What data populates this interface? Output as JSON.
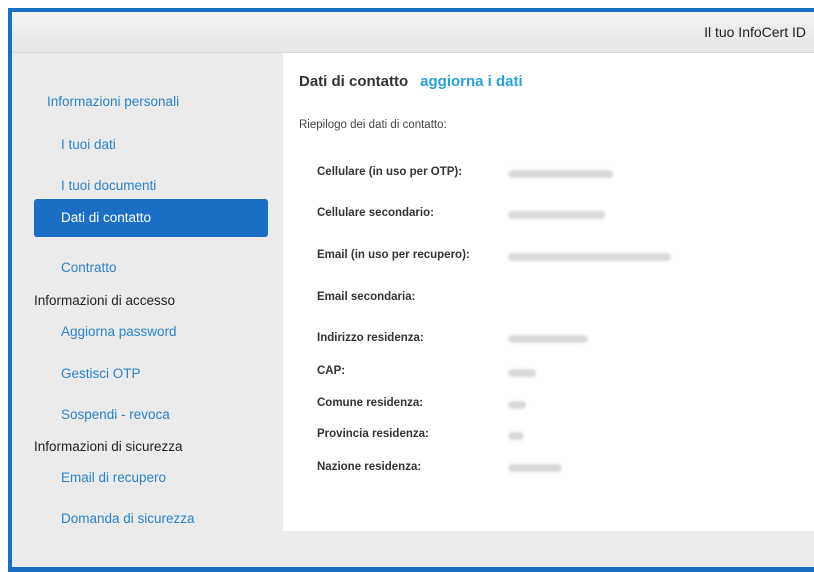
{
  "header": {
    "title": "Il tuo InfoCert ID"
  },
  "sidebar": {
    "sections": [
      {
        "label": "Informazioni personali",
        "is_link": true
      },
      {
        "label": "Informazioni di accesso",
        "is_link": false
      },
      {
        "label": "Informazioni di sicurezza",
        "is_link": false
      }
    ],
    "items": [
      {
        "label": "I tuoi dati"
      },
      {
        "label": "I tuoi documenti"
      },
      {
        "label": "Dati di contatto",
        "active": true
      },
      {
        "label": "Contratto"
      },
      {
        "label": "Aggiorna password"
      },
      {
        "label": "Gestisci OTP"
      },
      {
        "label": "Sospendi - revoca"
      },
      {
        "label": "Email di recupero"
      },
      {
        "label": "Domanda di sicurezza"
      }
    ]
  },
  "main": {
    "title": "Dati di contatto",
    "update_link": "aggiorna i dati",
    "summary": "Riepilogo dei dati di contatto:",
    "fields": [
      {
        "label": "Cellulare (in uso per OTP):",
        "value_hidden": true
      },
      {
        "label": "Cellulare secondario:",
        "value_hidden": true
      },
      {
        "label": "Email (in uso per recupero):",
        "value_hidden": true
      },
      {
        "label": "Email secondaria:",
        "value_hidden": false
      },
      {
        "label": "Indirizzo residenza:",
        "value_hidden": true
      },
      {
        "label": "CAP:",
        "value_hidden": true
      },
      {
        "label": "Comune residenza:",
        "value_hidden": true
      },
      {
        "label": "Provincia residenza:",
        "value_hidden": true
      },
      {
        "label": "Nazione residenza:",
        "value_hidden": true
      }
    ]
  },
  "colors": {
    "accent": "#1a6fc4",
    "link": "#2a83c9",
    "update_link": "#2a9fd8",
    "sidebar_bg": "#ebebeb",
    "content_bg": "#ffffff"
  }
}
